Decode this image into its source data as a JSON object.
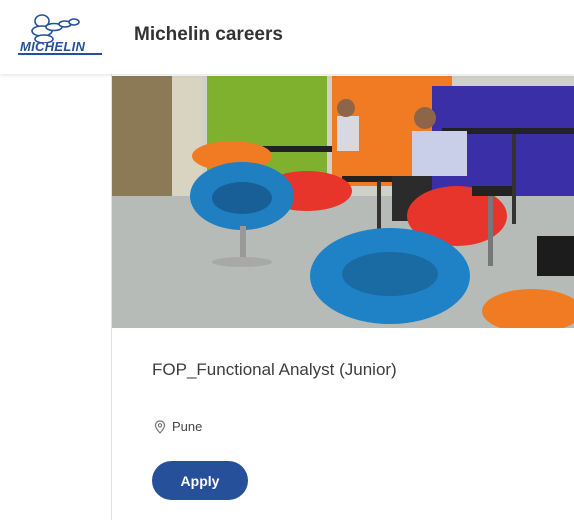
{
  "header": {
    "logo_text": "MICHELIN",
    "title": "Michelin careers"
  },
  "hero": {
    "icon": "office-lounge-photo"
  },
  "job": {
    "title": "FOP_Functional Analyst (Junior)",
    "location": "Pune",
    "location_icon": "map-pin-icon"
  },
  "actions": {
    "apply_label": "Apply"
  },
  "colors": {
    "brand_blue": "#27509b",
    "title_text": "#333333"
  }
}
